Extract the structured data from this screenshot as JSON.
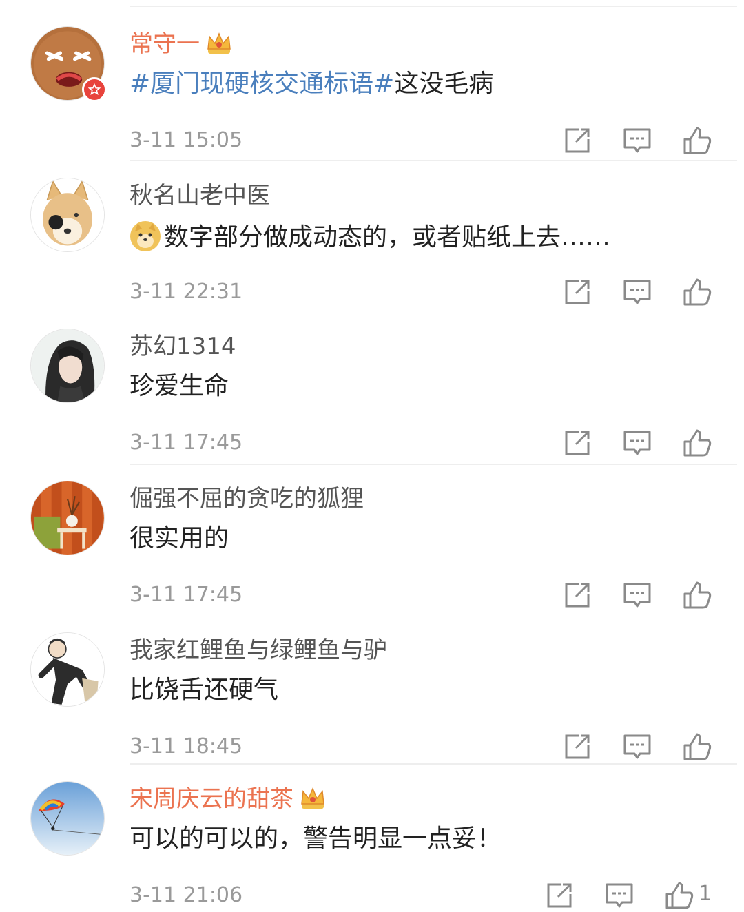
{
  "comments": [
    {
      "user": "常守一",
      "hashtag": "#厦门现硬核交通标语#",
      "text": "这没毛病",
      "time": "3-11 15:05"
    },
    {
      "user": "秋名山老中医",
      "text": "数字部分做成动态的，或者贴纸上去……",
      "time": "3-11 22:31"
    },
    {
      "user": "苏幻1314",
      "text": "珍爱生命",
      "time": "3-11 17:45"
    },
    {
      "user": "倔强不屈的贪吃的狐狸",
      "text": "很实用的",
      "time": "3-11 17:45"
    },
    {
      "user": "我家红鲤鱼与绿鲤鱼与驴",
      "text": "比饶舌还硬气",
      "time": "3-11 18:45"
    },
    {
      "user": "宋周庆云的甜茶",
      "text": "可以的可以的，警告明显一点妥！",
      "time": "3-11 21:06",
      "like_count": "1"
    }
  ],
  "colors": {
    "vip_name": "#eb7350",
    "name": "#555555",
    "hashtag": "#4a7fbd",
    "time": "#9a9a9a"
  },
  "icons": [
    "share-icon",
    "comment-icon",
    "like-icon",
    "crown-icon",
    "doge-emoji",
    "vip-badge-icon"
  ]
}
